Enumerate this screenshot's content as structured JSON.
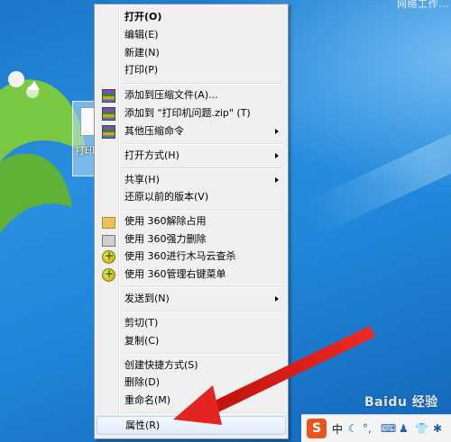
{
  "desktop": {
    "top_right_text": "网络工作...",
    "file_icon_label": "打印机"
  },
  "context_menu": {
    "items": [
      {
        "label": "打开(O)",
        "bold": true
      },
      {
        "label": "编辑(E)"
      },
      {
        "label": "新建(N)"
      },
      {
        "label": "打印(P)"
      },
      {
        "label": "添加到压缩文件(A)...",
        "icon": "winrar-icon"
      },
      {
        "label": "添加到 \"打印机问题.zip\" (T)",
        "icon": "winrar-icon"
      },
      {
        "label": "其他压缩命令",
        "icon": "winrar-icon",
        "submenu": true
      },
      {
        "label": "打开方式(H)",
        "submenu": true
      },
      {
        "label": "共享(H)",
        "submenu": true
      },
      {
        "label": "还原以前的版本(V)"
      },
      {
        "label": "使用 360解除占用",
        "icon": "folder-unlock-icon"
      },
      {
        "label": "使用 360强力删除",
        "icon": "shredder-icon"
      },
      {
        "label": "使用 360进行木马云查杀",
        "icon": "360-shield-icon"
      },
      {
        "label": "使用 360管理右键菜单",
        "icon": "360-shield-icon"
      },
      {
        "label": "发送到(N)",
        "submenu": true
      },
      {
        "label": "剪切(T)"
      },
      {
        "label": "复制(C)"
      },
      {
        "label": "创建快捷方式(S)"
      },
      {
        "label": "删除(D)"
      },
      {
        "label": "重命名(M)"
      },
      {
        "label": "属性(R)",
        "highlighted": true
      }
    ]
  },
  "annotation": {
    "arrow_color": "#e8231f"
  },
  "taskbar_tray": {
    "ime_logo": "S",
    "ime_mode": "中",
    "items": [
      "moon-icon",
      "punctuation-icon",
      "keyboard-icon",
      "user-icon",
      "shirt-icon",
      "settings-icon"
    ]
  },
  "watermark": "Baidu 经验"
}
